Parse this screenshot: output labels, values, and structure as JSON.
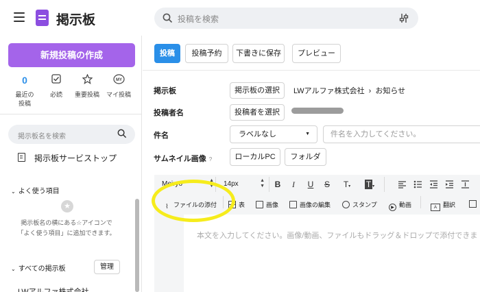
{
  "header": {
    "app_title": "掲示板",
    "search_placeholder": "投稿を検索",
    "menu_icon": "hamburger-icon",
    "logo_icon": "board-logo-icon",
    "filter_icon": "filter-icon"
  },
  "sidebar": {
    "new_post_label": "新規投稿の作成",
    "quick_links": [
      {
        "top": "0",
        "label": "最近の\n投稿",
        "icon": "count"
      },
      {
        "top": "",
        "label": "必読",
        "icon": "check-icon"
      },
      {
        "top": "",
        "label": "重要投稿",
        "icon": "star-icon"
      },
      {
        "top": "",
        "label": "マイ投稿",
        "icon": "my-icon"
      }
    ],
    "board_search_placeholder": "掲示板名を検索",
    "service_stop_label": "掲示板サービストップ",
    "favorites_label": "よく使う項目",
    "favorites_hint_line1": "掲示板名の横にある☆アイコンで",
    "favorites_hint_line2": "「よく使う項目」に追加できます。",
    "all_boards_label": "すべての掲示板",
    "manage_label": "管理",
    "bottom_truncated_text": "LWアルファ株式会社"
  },
  "main": {
    "actions": {
      "post": "投稿",
      "schedule": "投稿予約",
      "save_draft": "下書きに保存",
      "preview": "プレビュー"
    },
    "form": {
      "board_label": "掲示板",
      "board_select_button": "掲示板の選択",
      "board_company": "LWアルファ株式会社",
      "board_separator": "›",
      "board_name": "お知らせ",
      "author_label": "投稿者名",
      "author_select_button": "投稿者を選択",
      "subject_label": "件名",
      "label_select_value": "ラベルなし",
      "subject_placeholder": "件名を入力してください。",
      "thumbnail_label": "サムネイル画像",
      "thumbnail_help": "?",
      "local_pc_button": "ローカルPC",
      "folder_button": "フォルダ"
    },
    "editor": {
      "font_family": "Meiryo",
      "font_size": "14px",
      "format_buttons": [
        "B",
        "I",
        "U",
        "S",
        "T",
        "T"
      ],
      "attach_file": "ファイルの添付",
      "table": "表",
      "image": "画像",
      "image_edit": "画像の編集",
      "stamp": "スタンプ",
      "video": "動画",
      "translate": "翻訳",
      "body_placeholder": "本文を入力してください。画像/動画、ファイルもドラッグ＆ドロップで添付できま"
    }
  },
  "colors": {
    "brand_purple": "#a464ea",
    "primary_blue": "#2a8fe8",
    "highlight_yellow": "#f6ec1c"
  }
}
